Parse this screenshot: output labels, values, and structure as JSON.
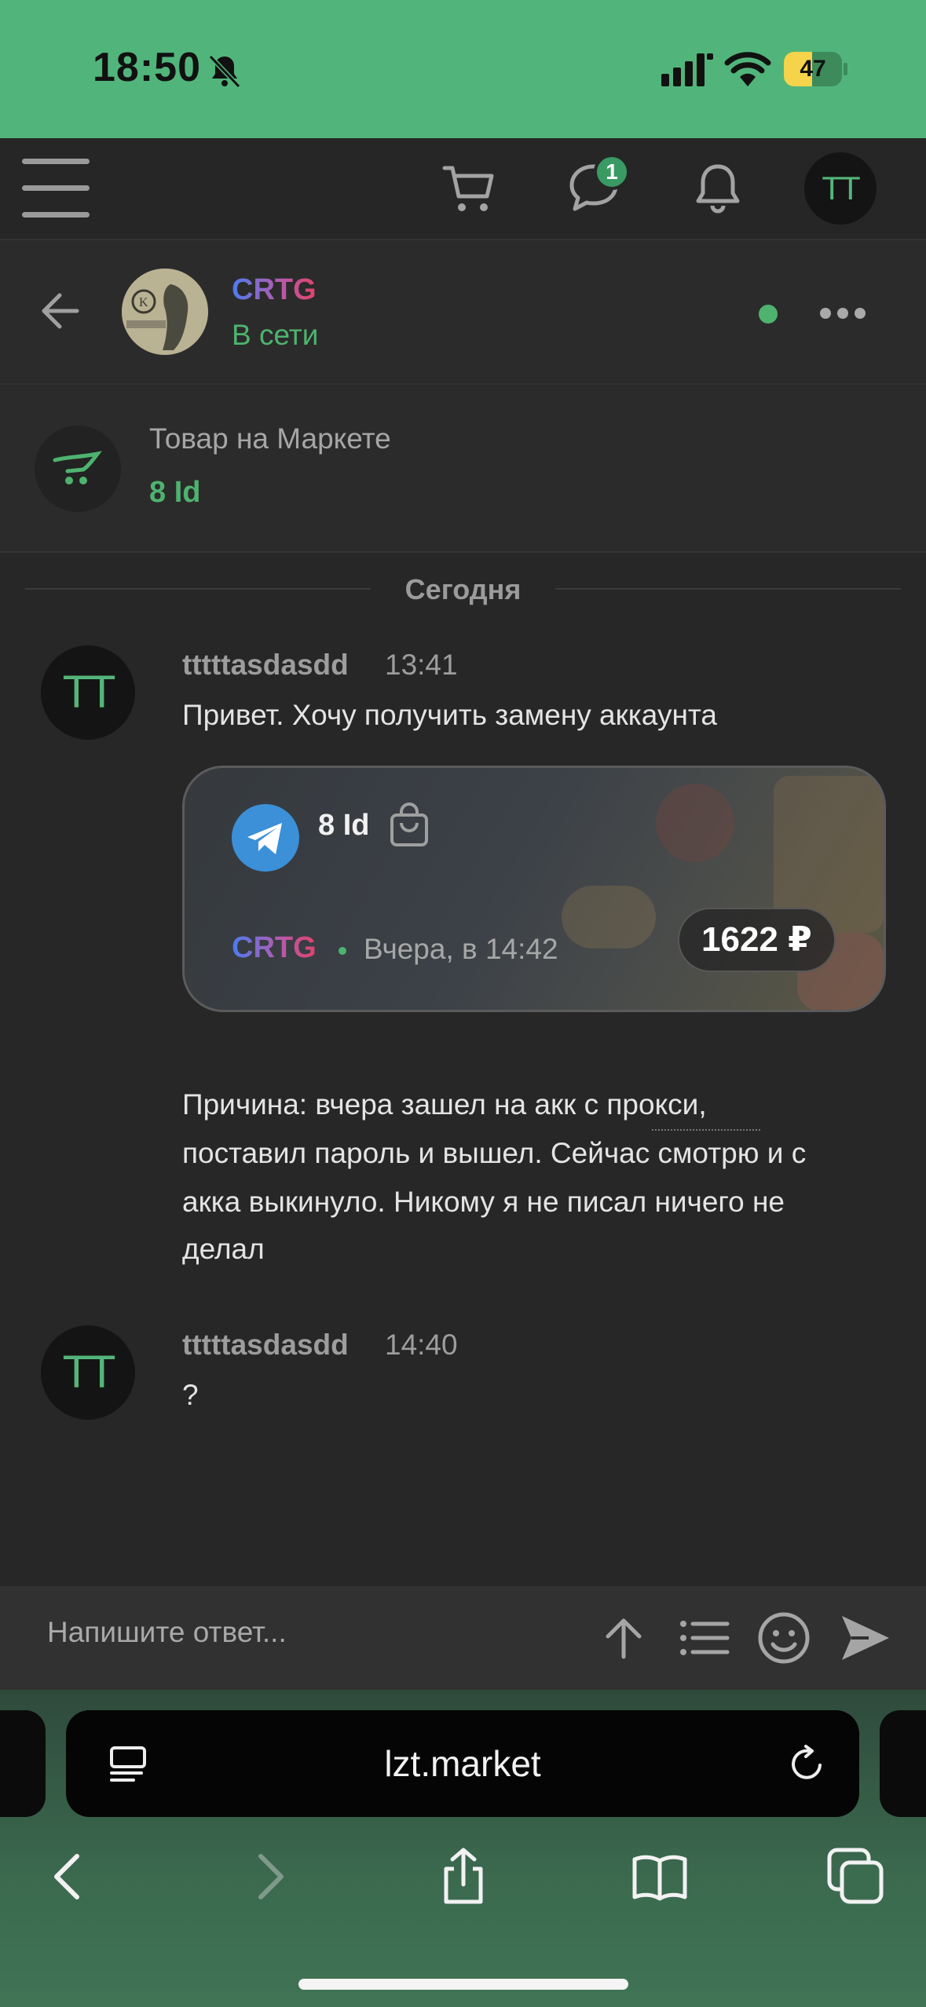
{
  "status_bar": {
    "time": "18:50",
    "battery": "47"
  },
  "header": {
    "messages_badge": "1",
    "user_initials": "TT"
  },
  "conversation": {
    "peer_name": "CRTG",
    "peer_status": "В сети"
  },
  "product": {
    "label": "Товар на Маркете",
    "title": "8 Id"
  },
  "date_divider": "Сегодня",
  "messages": [
    {
      "author": "tttttasdasdd",
      "time": "13:41",
      "initials": "TT",
      "text": "Привет. Хочу получить замену аккаунта"
    },
    {
      "author": "tttttasdasdd",
      "time": "14:40",
      "initials": "TT",
      "text": "?"
    }
  ],
  "reason_lines": [
    "Причина: вчера зашел на акк с прокси,",
    "поставил пароль и вышел. Сейчас смотрю и с",
    "акка выкинуло. Никому я не писал ничего не",
    "делал"
  ],
  "card": {
    "title": "8 Id",
    "seller": "CRTG",
    "date": "Вчера, в 14:42",
    "price": "1622 ₽"
  },
  "reply": {
    "placeholder": "Напишите ответ..."
  },
  "browser": {
    "url": "lzt.market"
  },
  "colors": {
    "accent": "#4eb36f",
    "status_bar": "#51b57b",
    "background": "#272727"
  }
}
